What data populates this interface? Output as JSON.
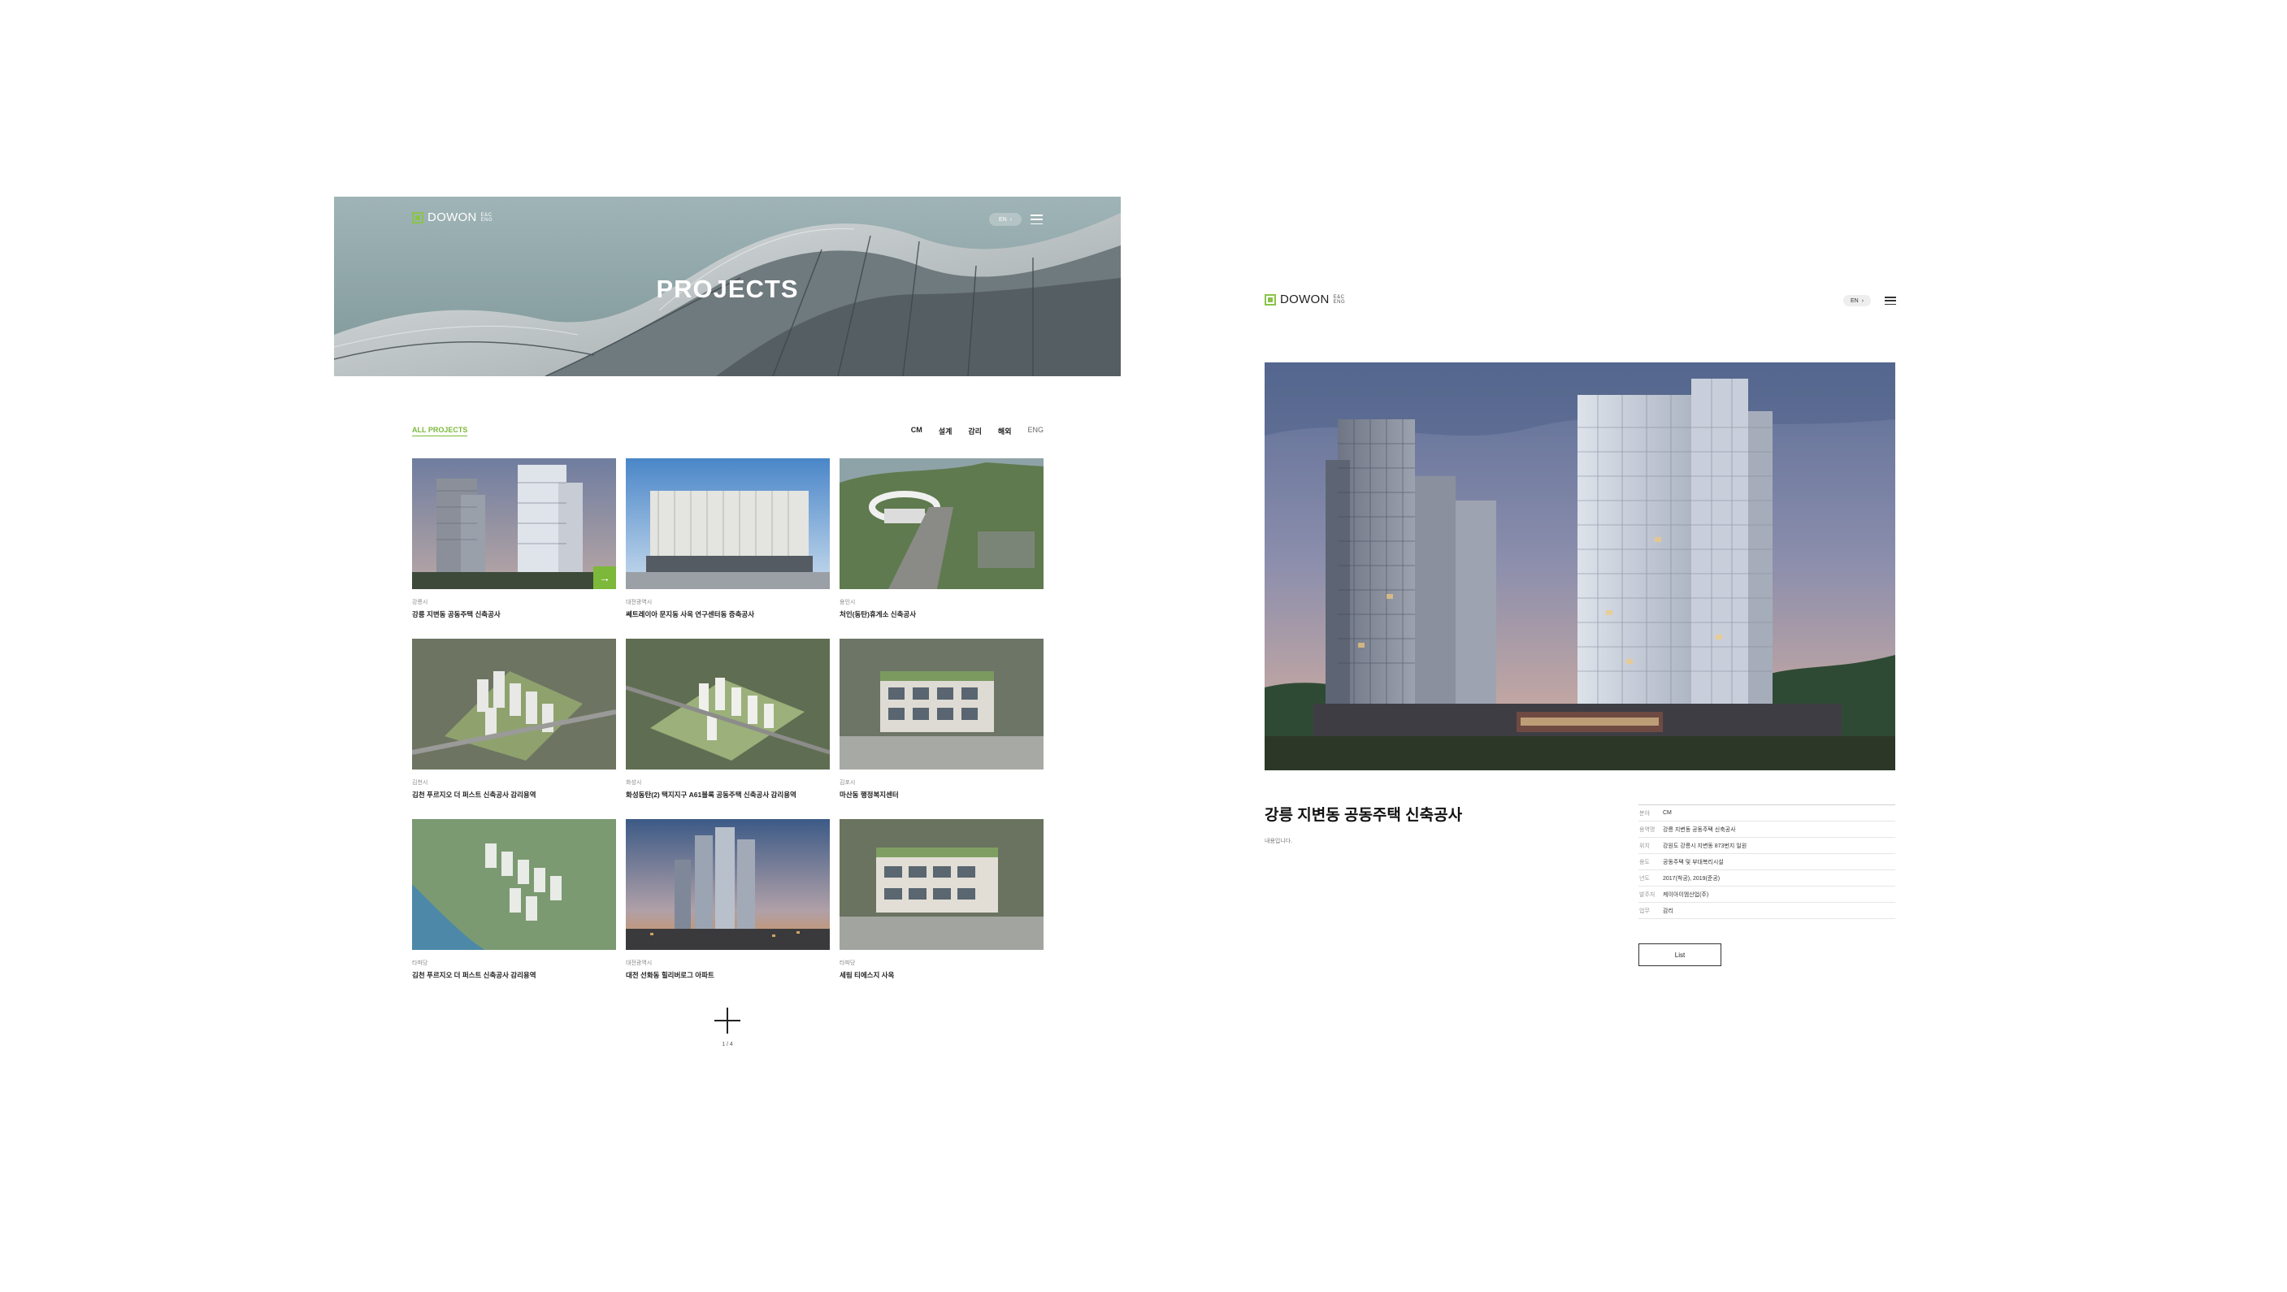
{
  "brand": {
    "name": "DOWON",
    "sub": "E&C ENG"
  },
  "language_toggle": "EN",
  "list_page": {
    "hero_title": "PROJECTS",
    "filter": {
      "all_label": "ALL PROJECTS",
      "tabs": [
        "CM",
        "설계",
        "감리",
        "해외",
        "ENG"
      ]
    },
    "projects": [
      {
        "category": "강릉시",
        "name": "강릉 지변동 공동주택 신축공사"
      },
      {
        "category": "대전광역시",
        "name": "쎄트레이아 문지동 사옥 연구센터동 증축공사"
      },
      {
        "category": "용인시",
        "name": "처인(동탄)휴게소 신축공사"
      },
      {
        "category": "김천시",
        "name": "김천 푸르지오 더 퍼스트 신축공사 감리용역"
      },
      {
        "category": "화성시",
        "name": "화성동탄(2) 택지지구 A61블록 공동주택 신축공사 감리용역"
      },
      {
        "category": "김포시",
        "name": "마산동 행정복지센터"
      },
      {
        "category": "타파당",
        "name": "김천 푸르지오 더 퍼스트 신축공사 감리용역"
      },
      {
        "category": "대전광역시",
        "name": "대전 선화동 힐리버로그 아파트"
      },
      {
        "category": "타파당",
        "name": "세림 티에스지 사옥"
      }
    ],
    "pagination": "1 / 4"
  },
  "detail_page": {
    "title": "강릉 지변동 공동주택 신축공사",
    "description": "내용입니다.",
    "info": [
      {
        "key": "분야",
        "value": "CM"
      },
      {
        "key": "용역명",
        "value": "강릉 지변동 공동주택 신축공사"
      },
      {
        "key": "위치",
        "value": "강원도 강릉시 지변동 873번지 일원"
      },
      {
        "key": "용도",
        "value": "공동주택 및 부대복리시설"
      },
      {
        "key": "년도",
        "value": "2017(착공), 2019(준공)"
      },
      {
        "key": "발주처",
        "value": "케이아이엠산업(주)"
      },
      {
        "key": "업무",
        "value": "감리"
      }
    ],
    "list_button": "List"
  },
  "colors": {
    "accent": "#7cb83a",
    "hero_bg": "#8fa6a8"
  }
}
